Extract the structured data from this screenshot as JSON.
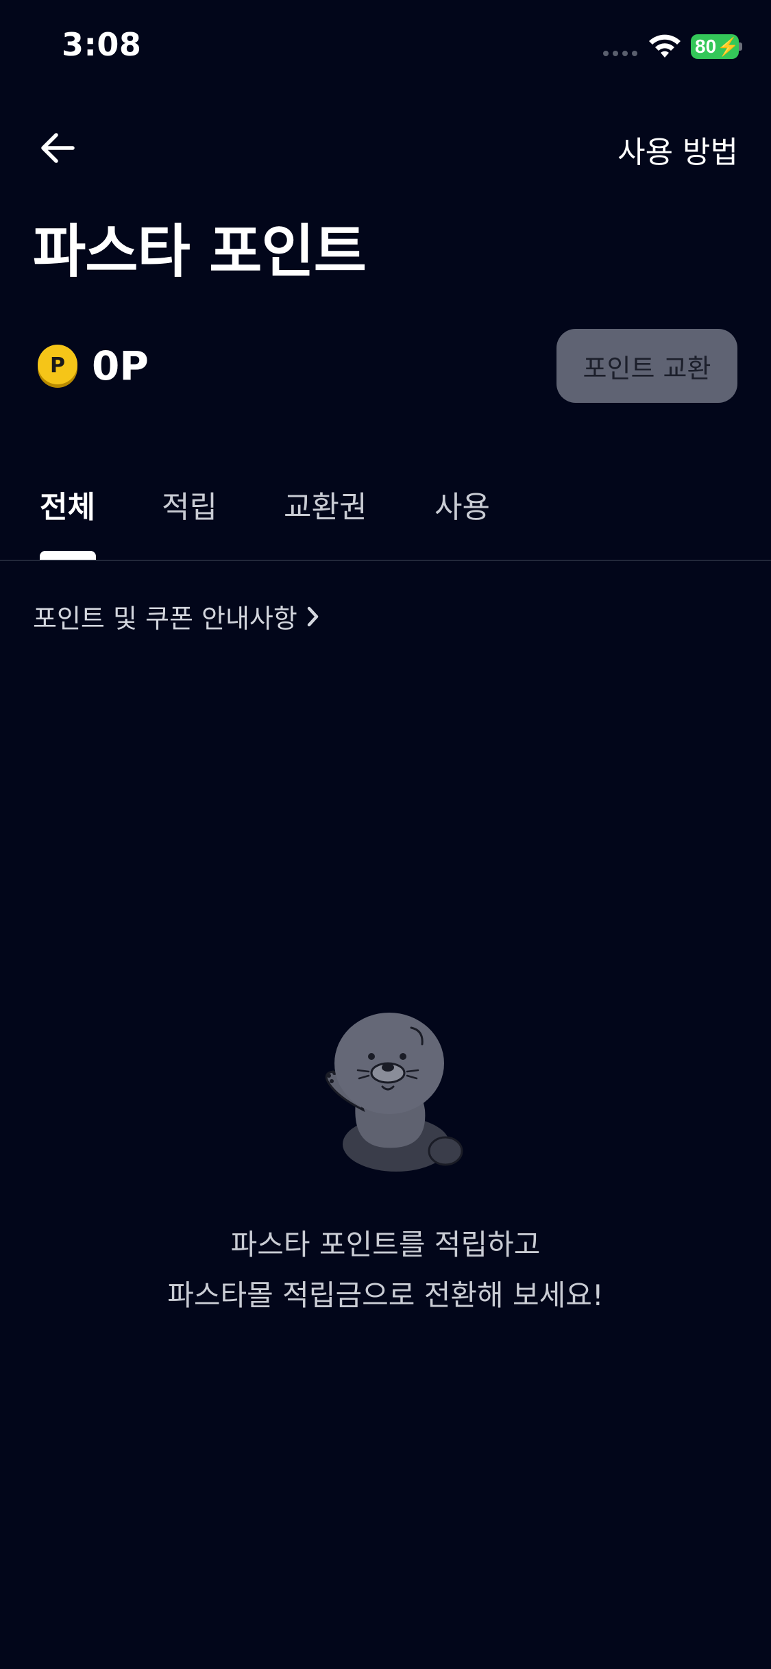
{
  "status_bar": {
    "time": "3:08",
    "battery_level": "80",
    "battery_color": "#34c759"
  },
  "header": {
    "back_icon": "arrow-left-icon",
    "usage_link": "사용 방법",
    "title": "파스타 포인트"
  },
  "points": {
    "coin_icon": "coin-p-icon",
    "coin_letter": "P",
    "value": "0P",
    "exchange_button": "포인트 교환"
  },
  "tabs": [
    {
      "label": "전체",
      "active": true
    },
    {
      "label": "적립",
      "active": false
    },
    {
      "label": "교환권",
      "active": false
    },
    {
      "label": "사용",
      "active": false
    }
  ],
  "notice": {
    "label": "포인트 및 쿠폰 안내사항",
    "icon": "chevron-right-icon"
  },
  "empty_state": {
    "illustration": "character-waving-icon",
    "line1": "파스타 포인트를 적립하고",
    "line2": "파스타몰 적립금으로 전환해 보세요!"
  },
  "colors": {
    "background": "#02061a",
    "coin": "#f5c518",
    "button_bg": "#5f6373"
  }
}
